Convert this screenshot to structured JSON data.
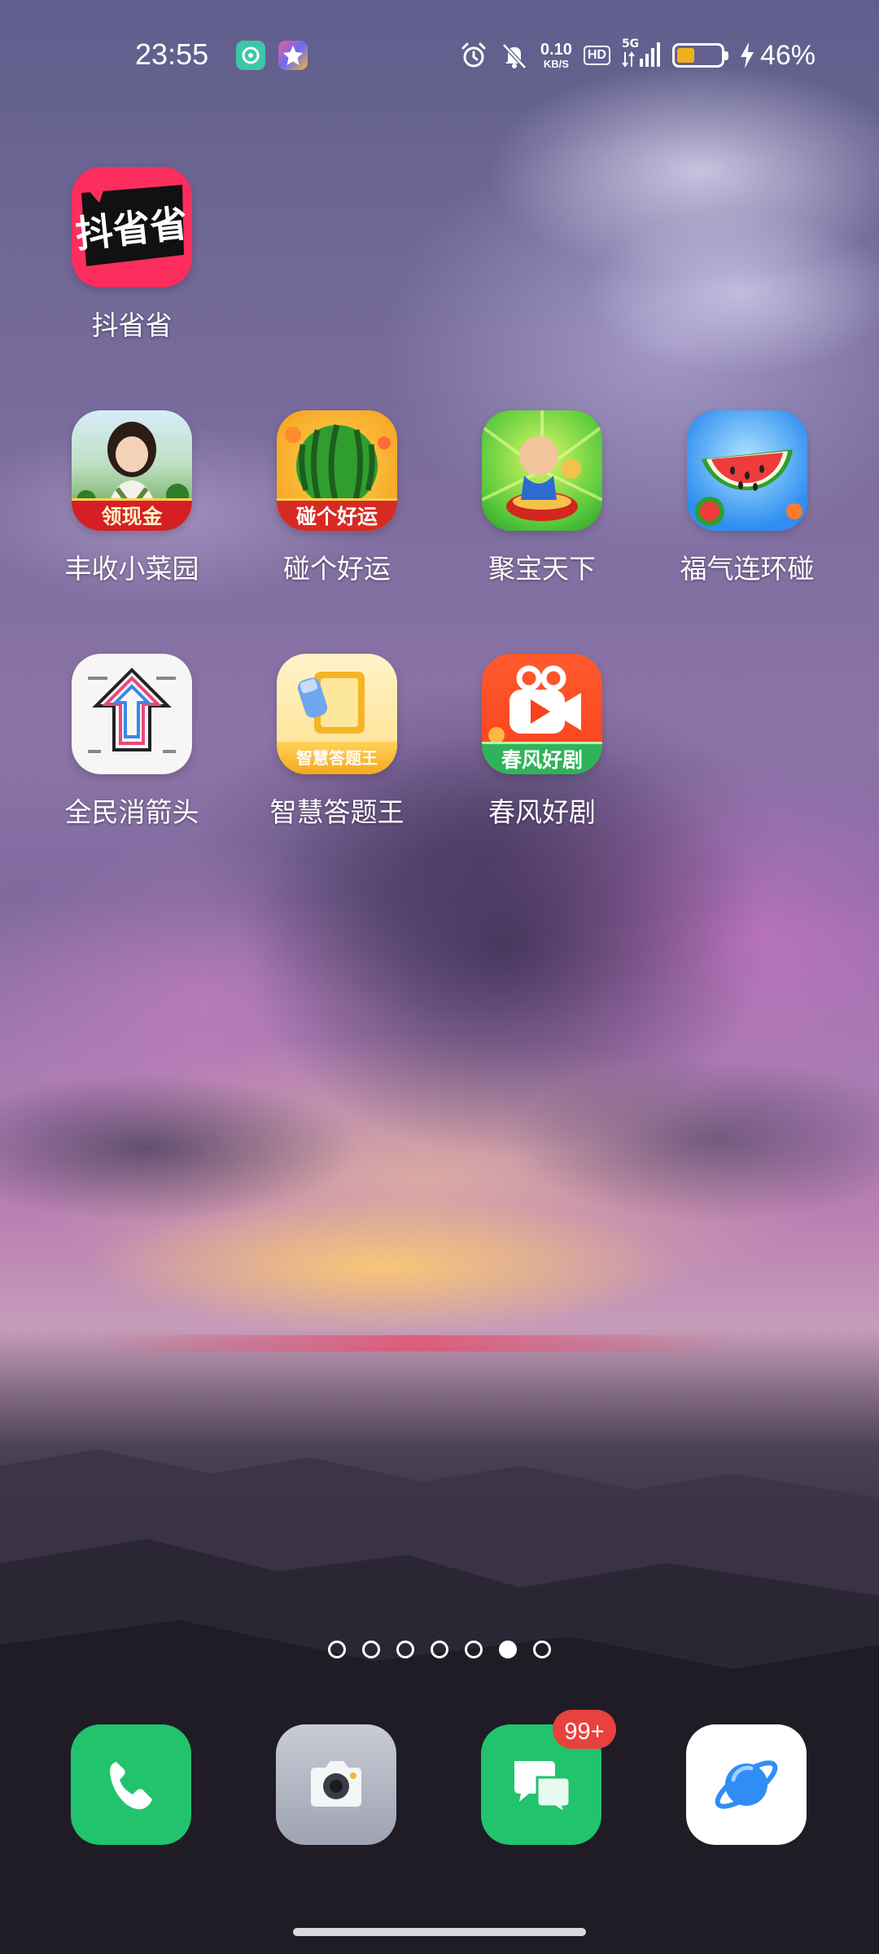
{
  "status_bar": {
    "time": "23:55",
    "net_speed_value": "0.10",
    "net_speed_unit": "KB/S",
    "hd_label": "HD",
    "network_type": "5G",
    "battery_percent": "46%",
    "battery_level": 0.46,
    "battery_color": "#f0b11b",
    "icons": [
      "alarm-icon",
      "mute-icon",
      "signal-icon",
      "charging-icon"
    ]
  },
  "home": {
    "apps": [
      {
        "label": "抖省省",
        "icon": "dousheng-icon",
        "icon_text": "抖省省"
      },
      {
        "label": "丰收小菜园",
        "icon": "harvest-garden-icon",
        "banner": "领现金"
      },
      {
        "label": "碰个好运",
        "icon": "watermelon-luck-icon",
        "banner": "碰个好运"
      },
      {
        "label": "聚宝天下",
        "icon": "treasure-icon"
      },
      {
        "label": "福气连环碰",
        "icon": "fortune-watermelon-icon"
      },
      {
        "label": "全民消箭头",
        "icon": "arrow-puzzle-icon"
      },
      {
        "label": "智慧答题王",
        "icon": "quiz-king-icon",
        "banner": "智慧答题王"
      },
      {
        "label": "春风好剧",
        "icon": "spring-drama-icon",
        "banner": "春风好剧"
      }
    ]
  },
  "pager": {
    "count": 7,
    "active_index": 5
  },
  "dock": {
    "apps": [
      {
        "name": "phone",
        "icon": "phone-icon"
      },
      {
        "name": "camera",
        "icon": "camera-icon"
      },
      {
        "name": "messages",
        "icon": "messages-icon",
        "badge": "99+"
      },
      {
        "name": "browser",
        "icon": "browser-planet-icon"
      }
    ]
  }
}
